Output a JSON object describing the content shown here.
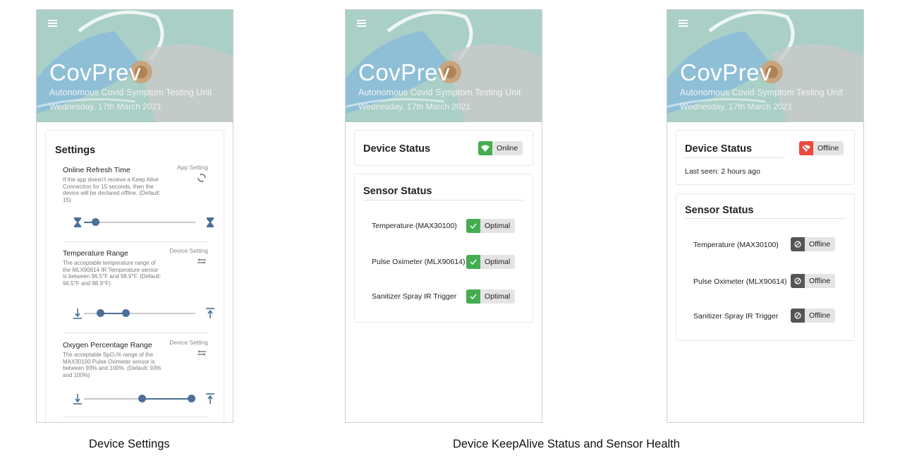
{
  "app": {
    "brand": "CovPrev",
    "subtitle": "Autonomous Covid Symptom Testing Unit",
    "date": "Wednesday, 17th March 2021"
  },
  "settings": {
    "title": "Settings",
    "items": [
      {
        "name": "Online Refresh Time",
        "kind": "App Setting",
        "description": "If the app doesn't receive a Keep Alive Connection for 15 seconds, then the device will be declared offline. (Default: 15)",
        "icon": "refresh-icon",
        "min_icon": "hourglass-icon",
        "max_icon": "hourglass-icon",
        "value_fraction": 0.07
      },
      {
        "name": "Temperature Range",
        "kind": "Device Setting",
        "description": "The acceptable temperature range of the MLX90614 IR Temperature sensor is between 96.5°F and 98.9°F. (Default: 96.5°F and 98.9°F)",
        "icon": "arrows-icon",
        "min_icon": "arrow-down-to-line-icon",
        "max_icon": "arrow-up-to-line-icon",
        "range_fraction": [
          0.15,
          0.39
        ]
      },
      {
        "name": "Oxygen Percentage Range",
        "kind": "Device Setting",
        "description": "The acceptable SpO₂% range of the MAX30100 Pulse Oximeter sensor is between 93% and 100%. (Default: 93% and 100%)",
        "icon": "arrows-icon",
        "min_icon": "arrow-down-to-line-icon",
        "max_icon": "arrow-up-to-line-icon",
        "range_fraction": [
          0.52,
          0.99
        ]
      }
    ]
  },
  "online_view": {
    "device_status_title": "Device Status",
    "device_status": "Online",
    "sensor_status_title": "Sensor Status",
    "sensors": [
      {
        "name": "Temperature (MAX30100)",
        "status": "Optimal"
      },
      {
        "name": "Pulse Oximeter (MLX90614)",
        "status": "Optimal"
      },
      {
        "name": "Sanitizer Spray IR Trigger",
        "status": "Optimal"
      }
    ]
  },
  "offline_view": {
    "device_status_title": "Device Status",
    "device_status": "Offline",
    "last_seen": "Last seen: 2 hours ago",
    "sensor_status_title": "Sensor Status",
    "sensors": [
      {
        "name": "Temperature (MAX30100)",
        "status": "Offline"
      },
      {
        "name": "Pulse Oximeter (MLX90614)",
        "status": "Offline"
      },
      {
        "name": "Sanitizer Spray IR Trigger",
        "status": "Offline"
      }
    ]
  },
  "captions": {
    "left": "Device Settings",
    "right": "Device KeepAlive Status and Sensor Health"
  },
  "colors": {
    "header_bg": "#a9cfc7",
    "slider_accent": "#4b6f97",
    "online_green": "#45ad51",
    "offline_red": "#e84a3c",
    "offline_dark": "#555555"
  }
}
